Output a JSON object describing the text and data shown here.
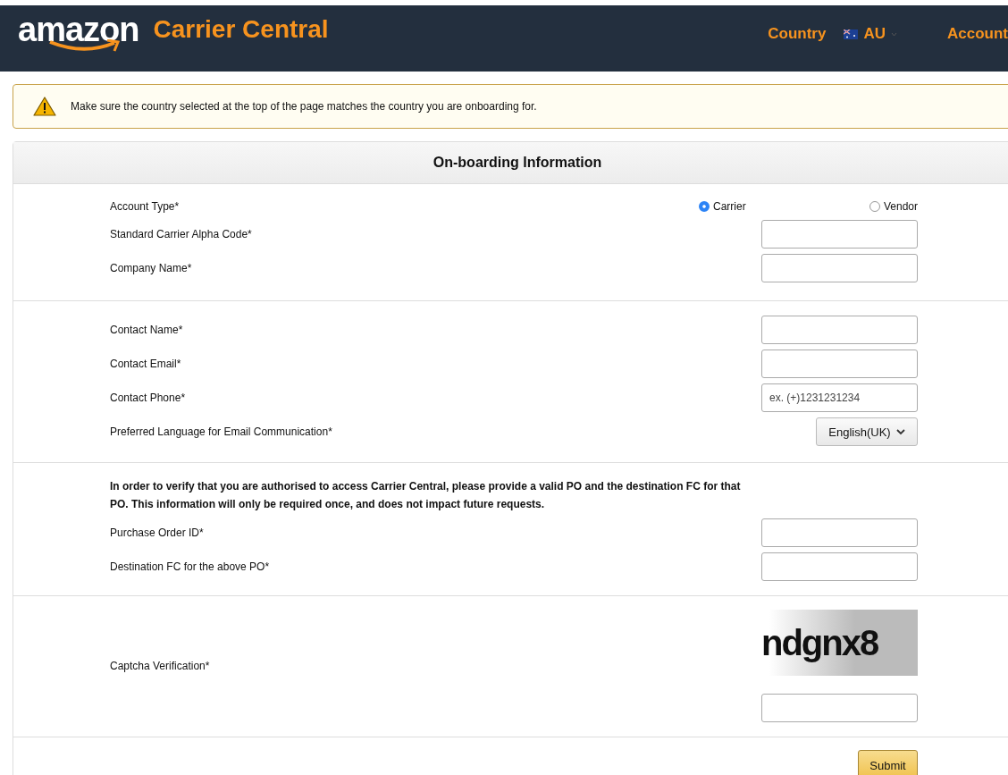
{
  "header": {
    "logo": "amazon",
    "title": "Carrier Central",
    "country_label": "Country",
    "country": "AU",
    "account": "Account"
  },
  "notice": {
    "text": "Make sure the country selected at the top of the page matches the country you are onboarding for."
  },
  "form": {
    "title": "On-boarding Information",
    "sections": [
      {
        "rows": [
          {
            "kind": "radio",
            "label": "Account Type*",
            "options": [
              {
                "label": "Carrier",
                "selected": true
              },
              {
                "label": "Vendor",
                "selected": false
              }
            ]
          },
          {
            "kind": "text",
            "label": "Standard Carrier Alpha Code*"
          },
          {
            "kind": "text",
            "label": "Company Name*"
          }
        ]
      },
      {
        "rows": [
          {
            "kind": "text",
            "label": "Contact Name*"
          },
          {
            "kind": "text",
            "label": "Contact Email*"
          },
          {
            "kind": "text",
            "label": "Contact Phone*",
            "placeholder": "ex. (+)1231231234"
          },
          {
            "kind": "select",
            "label": "Preferred Language for Email Communication*",
            "value": "English(UK)"
          }
        ]
      },
      {
        "rows": [
          {
            "kind": "paragraph",
            "text": "In order to verify that you are authorised to access Carrier Central, please provide a valid PO and the destination FC for that PO. This information will only be required once, and does not impact future requests."
          },
          {
            "kind": "text",
            "label": "Purchase Order ID*"
          },
          {
            "kind": "text",
            "label": "Destination FC for the above PO*"
          }
        ]
      },
      {
        "rows": [
          {
            "kind": "captcha",
            "label": "Captcha Verification*",
            "code": "ndgnx8"
          }
        ]
      }
    ],
    "submit": "Submit"
  }
}
